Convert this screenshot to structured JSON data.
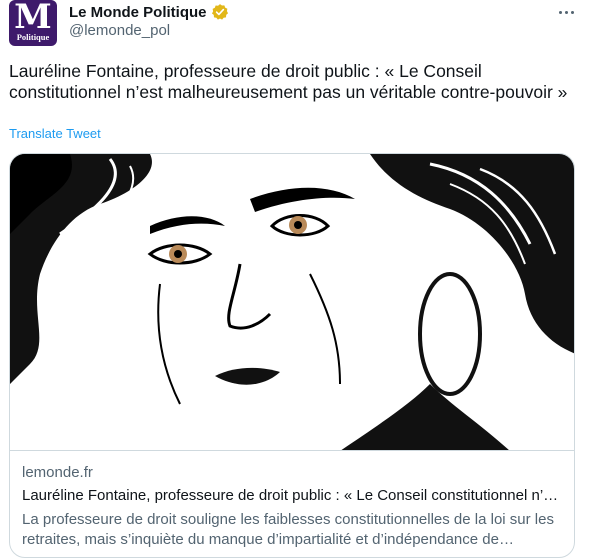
{
  "account": {
    "name": "Le Monde Politique",
    "handle": "@lemonde_pol",
    "avatar_letter": "M",
    "avatar_caption": "Politique",
    "avatar_color": "#3e1a6b",
    "verified_badge_color": "#e2b719",
    "icons": {
      "verified": "verified-badge-icon",
      "more": "more-options-icon"
    }
  },
  "tweet": {
    "text": "Lauréline Fontaine, professeure de droit public : « Le Conseil constitutionnel n’est malheureusement pas un véritable contre-pouvoir »",
    "translate_label": "Translate Tweet",
    "link_color": "#1d9bf0"
  },
  "card": {
    "domain": "lemonde.fr",
    "title": "Lauréline Fontaine, professeure de droit public : « Le Conseil constitutionnel n’est malheureusement pas un véritable contre-pouvoir »",
    "description": "La professeure de droit souligne les faiblesses constitutionnelles de la loi sur les retraites, mais s’inquiète du manque d’impartialité et d’indépendance de l’institution de la rue de Montpensier."
  }
}
